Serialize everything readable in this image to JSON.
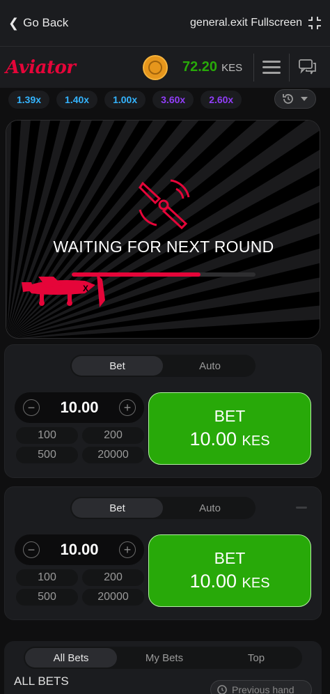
{
  "topbar": {
    "back_label": "Go Back",
    "fullscreen_label": "general.exit Fullscreen"
  },
  "header": {
    "logo": "Aviator",
    "balance_amount": "72.20",
    "balance_currency": "KES"
  },
  "history": {
    "multipliers": [
      {
        "value": "1.39x",
        "color": "#34b4ff"
      },
      {
        "value": "1.40x",
        "color": "#34b4ff"
      },
      {
        "value": "1.00x",
        "color": "#34b4ff"
      },
      {
        "value": "3.60x",
        "color": "#913ef8"
      },
      {
        "value": "2.60x",
        "color": "#913ef8"
      }
    ]
  },
  "game": {
    "status": "WAITING FOR NEXT ROUND",
    "progress_fraction": 0.7
  },
  "bet_panels": [
    {
      "tabs": [
        "Bet",
        "Auto"
      ],
      "active_tab": "Bet",
      "stake": "10.00",
      "quick_amounts": [
        "100",
        "200",
        "500",
        "20000"
      ],
      "button_title": "BET",
      "button_amount": "10.00",
      "button_currency": "KES"
    },
    {
      "tabs": [
        "Bet",
        "Auto"
      ],
      "active_tab": "Bet",
      "stake": "10.00",
      "quick_amounts": [
        "100",
        "200",
        "500",
        "20000"
      ],
      "button_title": "BET",
      "button_amount": "10.00",
      "button_currency": "KES"
    }
  ],
  "bets": {
    "tabs": [
      "All Bets",
      "My Bets",
      "Top"
    ],
    "active_tab": "All Bets",
    "title": "ALL BETS",
    "previous_hand_label": "Previous hand"
  },
  "colors": {
    "accent_red": "#e50539",
    "bet_green": "#28a909",
    "balance_green": "#28a909"
  }
}
